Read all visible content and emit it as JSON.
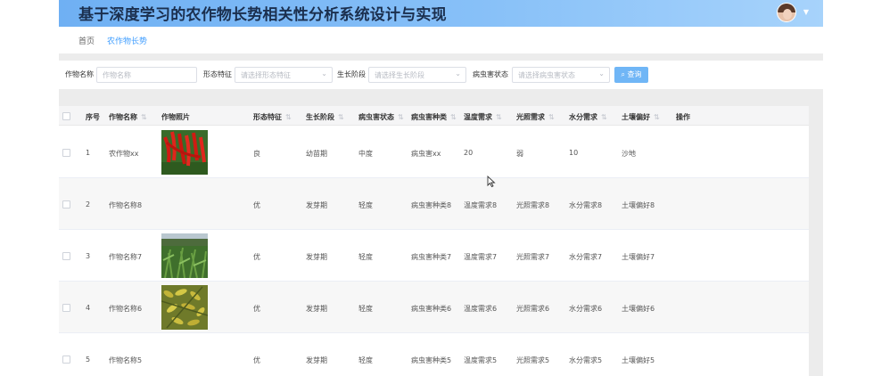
{
  "header": {
    "title": "基于深度学习的农作物长势相关性分析系统设计与实现"
  },
  "tabs": {
    "home": "首页",
    "active": "农作物长势"
  },
  "search": {
    "name_label": "作物名称",
    "name_placeholder": "作物名称",
    "shape_label": "形态特征",
    "shape_placeholder": "请选择形态特征",
    "stage_label": "生长阶段",
    "stage_placeholder": "请选择生长阶段",
    "pest_label": "病虫害状态",
    "pest_placeholder": "请选择病虫害状态",
    "query_label": "查询"
  },
  "table": {
    "columns": [
      "序号",
      "作物名称",
      "作物照片",
      "形态特征",
      "生长阶段",
      "病虫害状态",
      "病虫害种类",
      "温度需求",
      "光照需求",
      "水分需求",
      "土壤偏好",
      "操作"
    ],
    "rows": [
      {
        "no": "1",
        "name": "农作物xx",
        "shape": "良",
        "stage": "幼苗期",
        "pest": "中度",
        "pest_type": "病虫害xx",
        "temp": "20",
        "light": "弱",
        "water": "10",
        "soil": "沙地",
        "photo": "chili"
      },
      {
        "no": "2",
        "name": "作物名称8",
        "shape": "优",
        "stage": "发芽期",
        "pest": "轻度",
        "pest_type": "病虫害种类8",
        "temp": "温度需求8",
        "light": "光照需求8",
        "water": "水分需求8",
        "soil": "土壤偏好8",
        "photo": "none"
      },
      {
        "no": "3",
        "name": "作物名称7",
        "shape": "优",
        "stage": "发芽期",
        "pest": "轻度",
        "pest_type": "病虫害种类7",
        "temp": "温度需求7",
        "light": "光照需求7",
        "water": "水分需求7",
        "soil": "土壤偏好7",
        "photo": "corn"
      },
      {
        "no": "4",
        "name": "作物名称6",
        "shape": "优",
        "stage": "发芽期",
        "pest": "轻度",
        "pest_type": "病虫害种类6",
        "temp": "温度需求6",
        "light": "光照需求6",
        "water": "水分需求6",
        "soil": "土壤偏好6",
        "photo": "soybean"
      },
      {
        "no": "5",
        "name": "作物名称5",
        "shape": "优",
        "stage": "发芽期",
        "pest": "轻度",
        "pest_type": "病虫害种类5",
        "temp": "温度需求5",
        "light": "光照需求5",
        "water": "水分需求5",
        "soil": "土壤偏好5",
        "photo": "none"
      }
    ]
  }
}
